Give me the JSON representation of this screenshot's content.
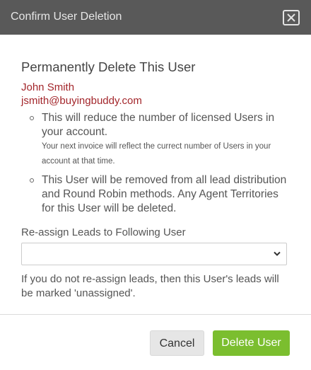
{
  "header": {
    "title": "Confirm User Deletion",
    "close_icon": "close-icon"
  },
  "main": {
    "section_title": "Permanently Delete This User",
    "user_name": "John Smith",
    "user_email": "jsmith@buyingbuddy.com",
    "bullets": [
      {
        "text": "This will reduce the number of licensed Users in your account.",
        "note": "Your next invoice will reflect the currect number of Users in your account at that time."
      },
      {
        "text": "This User will be removed from all lead distribution and Round Robin methods. Any Agent Territories for this User will be deleted."
      }
    ],
    "select_label": "Re-assign Leads to Following User",
    "select_value": "",
    "help_text": "If you do not re-assign leads, then this User's leads will be marked 'unassigned'."
  },
  "footer": {
    "cancel_label": "Cancel",
    "delete_label": "Delete User"
  },
  "colors": {
    "header_bg": "#595959",
    "accent_red": "#a3262b",
    "delete_green": "#7bbe2f"
  }
}
